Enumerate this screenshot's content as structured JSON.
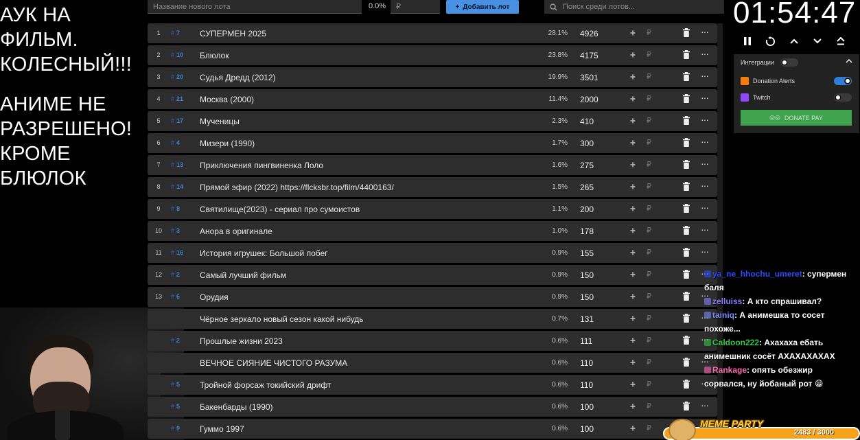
{
  "overlay": {
    "lines": [
      "АУК НА",
      "ФИЛЬМ.",
      "КОЛЕСНЫЙ!!!",
      "АНИМЕ НЕ",
      "РАЗРЕШЕНО!",
      "КРОМЕ",
      "БЛЮЛОК"
    ]
  },
  "topbar": {
    "lot_placeholder": "Название нового лота",
    "percent": "0.0%",
    "amount_placeholder": "₽",
    "add_label": "Добавить лот",
    "search_placeholder": "Поиск среди лотов..."
  },
  "lots": [
    {
      "num": "1",
      "id": "7",
      "name": "СУПЕРМЕН 2025",
      "pct": "28.1%",
      "amount": "4926"
    },
    {
      "num": "2",
      "id": "10",
      "name": "Блюлок",
      "pct": "23.8%",
      "amount": "4175"
    },
    {
      "num": "3",
      "id": "20",
      "name": "Судья Дредд (2012)",
      "pct": "19.9%",
      "amount": "3501"
    },
    {
      "num": "4",
      "id": "21",
      "name": "Москва (2000)",
      "pct": "11.4%",
      "amount": "2000"
    },
    {
      "num": "5",
      "id": "17",
      "name": "Мученицы",
      "pct": "2.3%",
      "amount": "410"
    },
    {
      "num": "6",
      "id": "4",
      "name": "Мизери (1990)",
      "pct": "1.7%",
      "amount": "300"
    },
    {
      "num": "7",
      "id": "13",
      "name": "Приключения пингвиненка Лоло",
      "pct": "1.6%",
      "amount": "275"
    },
    {
      "num": "8",
      "id": "14",
      "name": "Прямой эфир (2022) https://flcksbr.top/film/4400163/",
      "pct": "1.5%",
      "amount": "265"
    },
    {
      "num": "9",
      "id": "8",
      "name": "Святилище(2023) - сериал про сумоистов",
      "pct": "1.1%",
      "amount": "200"
    },
    {
      "num": "10",
      "id": "3",
      "name": "Анора в оригинале",
      "pct": "1.0%",
      "amount": "178"
    },
    {
      "num": "11",
      "id": "16",
      "name": "История игрушек: Большой побег",
      "pct": "0.9%",
      "amount": "155"
    },
    {
      "num": "12",
      "id": "2",
      "name": "Самый лучший фильм",
      "pct": "0.9%",
      "amount": "150"
    },
    {
      "num": "13",
      "id": "6",
      "name": "Орудия",
      "pct": "0.9%",
      "amount": "150"
    },
    {
      "num": "",
      "id": "",
      "name": "Чёрное зеркало новый сезон какой нибудь",
      "pct": "0.7%",
      "amount": "131"
    },
    {
      "num": "",
      "id": "2",
      "name": "Прошлые жизни 2023",
      "pct": "0.6%",
      "amount": "111"
    },
    {
      "num": "",
      "id": "",
      "name": "ВЕЧНОЕ СИЯНИЕ ЧИСТОГО РАЗУМА",
      "pct": "0.6%",
      "amount": "110"
    },
    {
      "num": "",
      "id": "5",
      "name": "Тройной форсаж токийский дрифт",
      "pct": "0.6%",
      "amount": "110"
    },
    {
      "num": "",
      "id": "5",
      "name": "Бакенбарды (1990)",
      "pct": "0.6%",
      "amount": "100"
    },
    {
      "num": "",
      "id": "9",
      "name": "Гуммо 1997",
      "pct": "0.6%",
      "amount": "100"
    }
  ],
  "row_icons": {
    "plus": "+",
    "rub": "₽",
    "more": "···"
  },
  "timer": "01:54:47",
  "integrations": {
    "title": "Интеграции",
    "donation_alerts": "Donation Alerts",
    "twitch": "Twitch",
    "donate_pay": "DONATE PAY"
  },
  "chat": [
    {
      "user": "ya_ne_hhochu_umeret",
      "color": "#2b4cff",
      "text": ": супермен"
    },
    {
      "user": "",
      "color": "#ffffff",
      "text": "баля"
    },
    {
      "user": "zelluiss",
      "color": "#8a7cff",
      "text": ": А кто спрашивал?"
    },
    {
      "user": "tainiq",
      "color": "#7b8cff",
      "text": ": А анимешка то сосет"
    },
    {
      "user": "",
      "color": "#ffffff",
      "text": "похоже..."
    },
    {
      "user": "Caldoon222",
      "color": "#2ecc40",
      "text": ": Ахахаха ебать"
    },
    {
      "user": "",
      "color": "#ffffff",
      "text": "анимешник сосёт АХАХАХАХАХ"
    },
    {
      "user": "Rankage",
      "color": "#ff69b4",
      "text": ": опять обезжир"
    },
    {
      "user": "",
      "color": "#ffffff",
      "text": "сорвался, ну йобаный рот 😁"
    }
  ],
  "meme_party": {
    "title": "MEME PARTY",
    "score": "2483 / 3000"
  }
}
